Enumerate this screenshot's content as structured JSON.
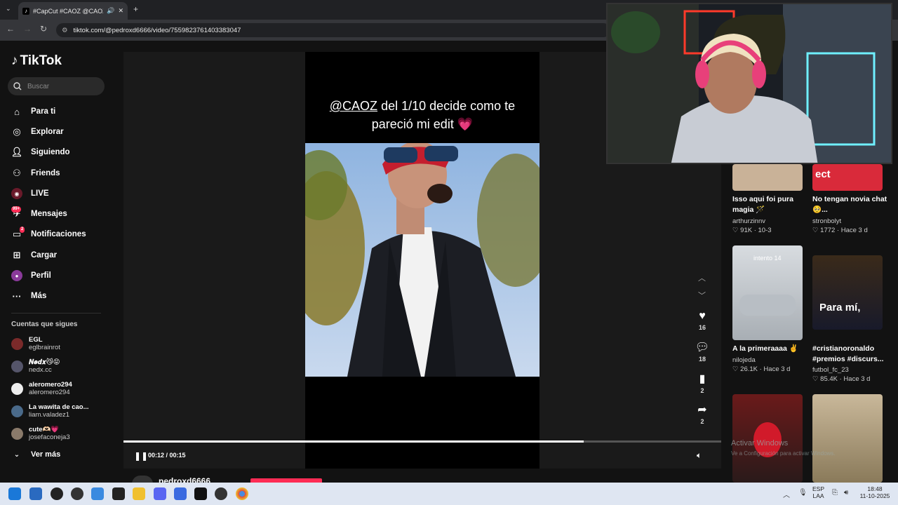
{
  "browser": {
    "tab_title": "#CapCut #CAOZ @CAOZ #",
    "url": "tiktok.com/@pedroxd6666/video/7559823761403383047"
  },
  "sidebar": {
    "brand": "TikTok",
    "search_placeholder": "Buscar",
    "nav": [
      {
        "label": "Para ti",
        "icon": "home-icon"
      },
      {
        "label": "Explorar",
        "icon": "compass-icon"
      },
      {
        "label": "Siguiendo",
        "icon": "user-follow-icon"
      },
      {
        "label": "Friends",
        "icon": "friends-icon"
      },
      {
        "label": "LIVE",
        "icon": "live-icon"
      },
      {
        "label": "Mensajes",
        "icon": "message-icon",
        "badge": "99+"
      },
      {
        "label": "Notificaciones",
        "icon": "inbox-icon",
        "badge": "2"
      },
      {
        "label": "Cargar",
        "icon": "upload-icon"
      },
      {
        "label": "Perfil",
        "icon": "profile-icon"
      },
      {
        "label": "Más",
        "icon": "more-icon"
      }
    ],
    "following_title": "Cuentas que sigues",
    "accounts": [
      {
        "name": "EGL",
        "handle": "eglbrainrot",
        "color": "#7a2a2a"
      },
      {
        "name": "𝑵𝒆𝒅𝒙😼😝",
        "handle": "nedx.cc",
        "color": "#55556a"
      },
      {
        "name": "aleromero294",
        "handle": "aleromero294",
        "color": "#eeeeee"
      },
      {
        "name": "La wawita de cao...",
        "handle": "liam.valadez1",
        "color": "#4a6a8a"
      },
      {
        "name": "cute🫶🏻💗",
        "handle": "josefaconeja3",
        "color": "#8a7a6a"
      }
    ],
    "see_more": "Ver más"
  },
  "video": {
    "caption_mention": "@CAOZ",
    "caption_line1_rest": " del 1/10 decide como te",
    "caption_line2": "pareció mi edit 💗",
    "time": "00:12 / 00:15",
    "progress": 0.77,
    "likes": "16",
    "comments": "18",
    "saves": "2",
    "shares": "2",
    "author": "pedroxd6666"
  },
  "related": [
    {
      "title": "Isso aqui foi pura magia 🪄",
      "author": "arthurzinnv",
      "stats": "♡ 91K · 10-3"
    },
    {
      "title": "No tengan novia chat 🥺...",
      "author": "stronbolyt",
      "stats": "♡ 1772 · Hace 3 d"
    },
    {
      "title": "A la primeraaaa ✌️",
      "author": "nilojeda",
      "stats": "♡ 26.1K · Hace 3 d",
      "thumb_text": "intento 14"
    },
    {
      "title": "#cristianoronaldo #premios #discurs...",
      "author": "futbol_fc_23",
      "stats": "♡ 85.4K · Hace 3 d",
      "thumb_text": "Para mí,"
    }
  ],
  "thumb_texts": {
    "top_right": "ect"
  },
  "watermark": {
    "line1": "Activar Windows",
    "line2": "Ve a Configuración para activar Windows."
  },
  "taskbar": {
    "lang": "ESP",
    "lang2": "LAA",
    "time": "18:48",
    "date": "11-10-2025"
  },
  "colors": {
    "accent": "#fe2c55",
    "background": "#121212"
  }
}
